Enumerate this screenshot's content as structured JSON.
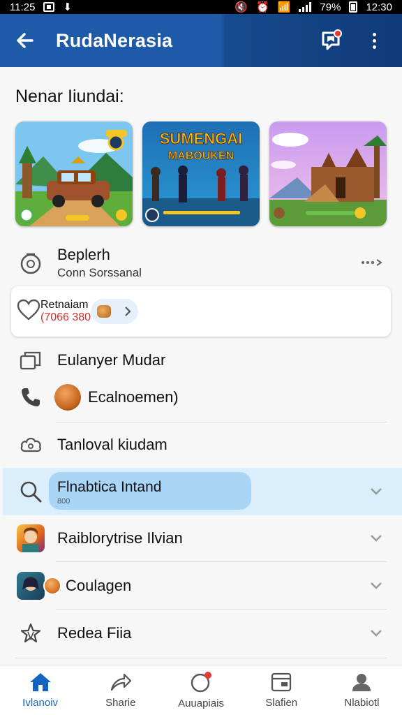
{
  "status_bar": {
    "time_left": "11:25",
    "battery": "79%",
    "time_right": "12:30"
  },
  "app_bar": {
    "title": "RudaNerasia"
  },
  "section_title": "Nenar Iiundai:",
  "thumbnails": [
    {
      "name": "thumb-car-game",
      "caption": ""
    },
    {
      "name": "thumb-sumengai",
      "title_line1": "SUMENGAI",
      "title_line2": "MABOUKEN"
    },
    {
      "name": "thumb-temple-game"
    }
  ],
  "rows": {
    "beplerh": {
      "main": "Beplerh",
      "sub": "Conn Sorssanal"
    },
    "retnaiam": {
      "main": "Retnaiam",
      "sub": "(7066 380"
    },
    "eulanyer": {
      "main": "Eulanyer Mudar"
    },
    "ecalnoemen": {
      "main": "Ecalnoemen)"
    },
    "tanloval": {
      "main": "Tanloval kiudam"
    },
    "flnabtica": {
      "main": "Flnabtica Intand",
      "sub": "800"
    },
    "raiblorytrise": {
      "main": "Raiblorytrise Ilvian"
    },
    "coulagen": {
      "main": "Coulagen"
    },
    "redea": {
      "main": "Redea Fiia"
    }
  },
  "bottom_nav": [
    {
      "label": "Ivlanoiv",
      "icon": "home-icon",
      "active": true
    },
    {
      "label": "Sharie",
      "icon": "share-icon",
      "active": false
    },
    {
      "label": "Auuapiais",
      "icon": "notification-icon",
      "active": false
    },
    {
      "label": "Slafien",
      "icon": "station-icon",
      "active": false
    },
    {
      "label": "Nlabiotl",
      "icon": "profile-icon",
      "active": false
    }
  ],
  "colors": {
    "app_bar": "#1f5aa8",
    "accent": "#1565c0",
    "highlight": "#dbeefc",
    "alert": "#d32f2f"
  }
}
